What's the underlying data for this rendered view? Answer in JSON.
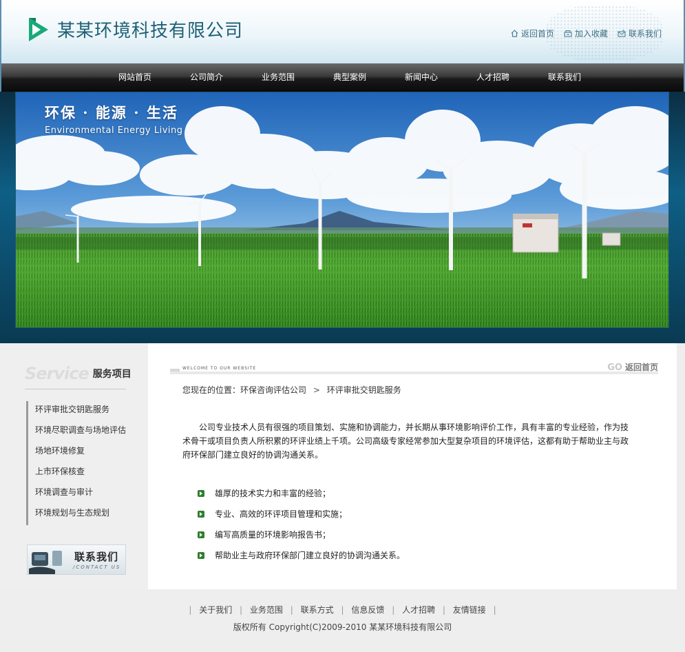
{
  "header": {
    "company_name": "某某环境科技有限公司",
    "toplinks": [
      {
        "label": "返回首页",
        "icon": "home-icon"
      },
      {
        "label": "加入收藏",
        "icon": "favorite-icon"
      },
      {
        "label": "联系我们",
        "icon": "contact-icon"
      }
    ]
  },
  "nav": {
    "items": [
      "网站首页",
      "公司简介",
      "业务范围",
      "典型案例",
      "新闻中心",
      "人才招聘",
      "联系我们"
    ]
  },
  "banner": {
    "slogan_cn": "环保 · 能源 · 生活",
    "slogan_en": "Environmental  Energy  Living"
  },
  "sidebar": {
    "title_en": "Service",
    "title_cn": "服务项目",
    "items": [
      "环评审批交钥匙服务",
      "环境尽职调查与场地评估",
      "场地环境修复",
      "上市环保核查",
      "环境调查与审计",
      "环境规划与生态规划"
    ],
    "contact_cn": "联系我们",
    "contact_en": "/CONTACT US"
  },
  "main": {
    "welcome": "WELCOME TO OUR WEBSITE",
    "go_word": "GO",
    "go_label": "返回首页",
    "breadcrumb": {
      "prefix": "您现在的位置：环保咨询评估公司",
      "separator": ">",
      "current": "环评审批交钥匙服务"
    },
    "intro": "公司专业技术人员有很强的项目策划、实施和协调能力，并长期从事环境影响评价工作，具有丰富的专业经验，作为技术骨干或项目负责人所积累的环评业绩上千项。公司高级专家经常参加大型复杂项目的环境评估，这都有助于帮助业主与政府环保部门建立良好的协调沟通关系。",
    "bullets": [
      "雄厚的技术实力和丰富的经验；",
      "专业、高效的环评项目管理和实施；",
      "编写高质量的环境影响报告书；",
      "帮助业主与政府环保部门建立良好的协调沟通关系。"
    ]
  },
  "footer": {
    "links": [
      "关于我们",
      "业务范围",
      "联系方式",
      "信息反馈",
      "人才招聘",
      "友情链接"
    ],
    "copyright": "版权所有  Copyright(C)2009-2010 某某环境科技有限公司"
  },
  "colors": {
    "brand": "#1e6076",
    "logo_green": "#19a97a",
    "bullet_green": "#2f7d2f"
  }
}
